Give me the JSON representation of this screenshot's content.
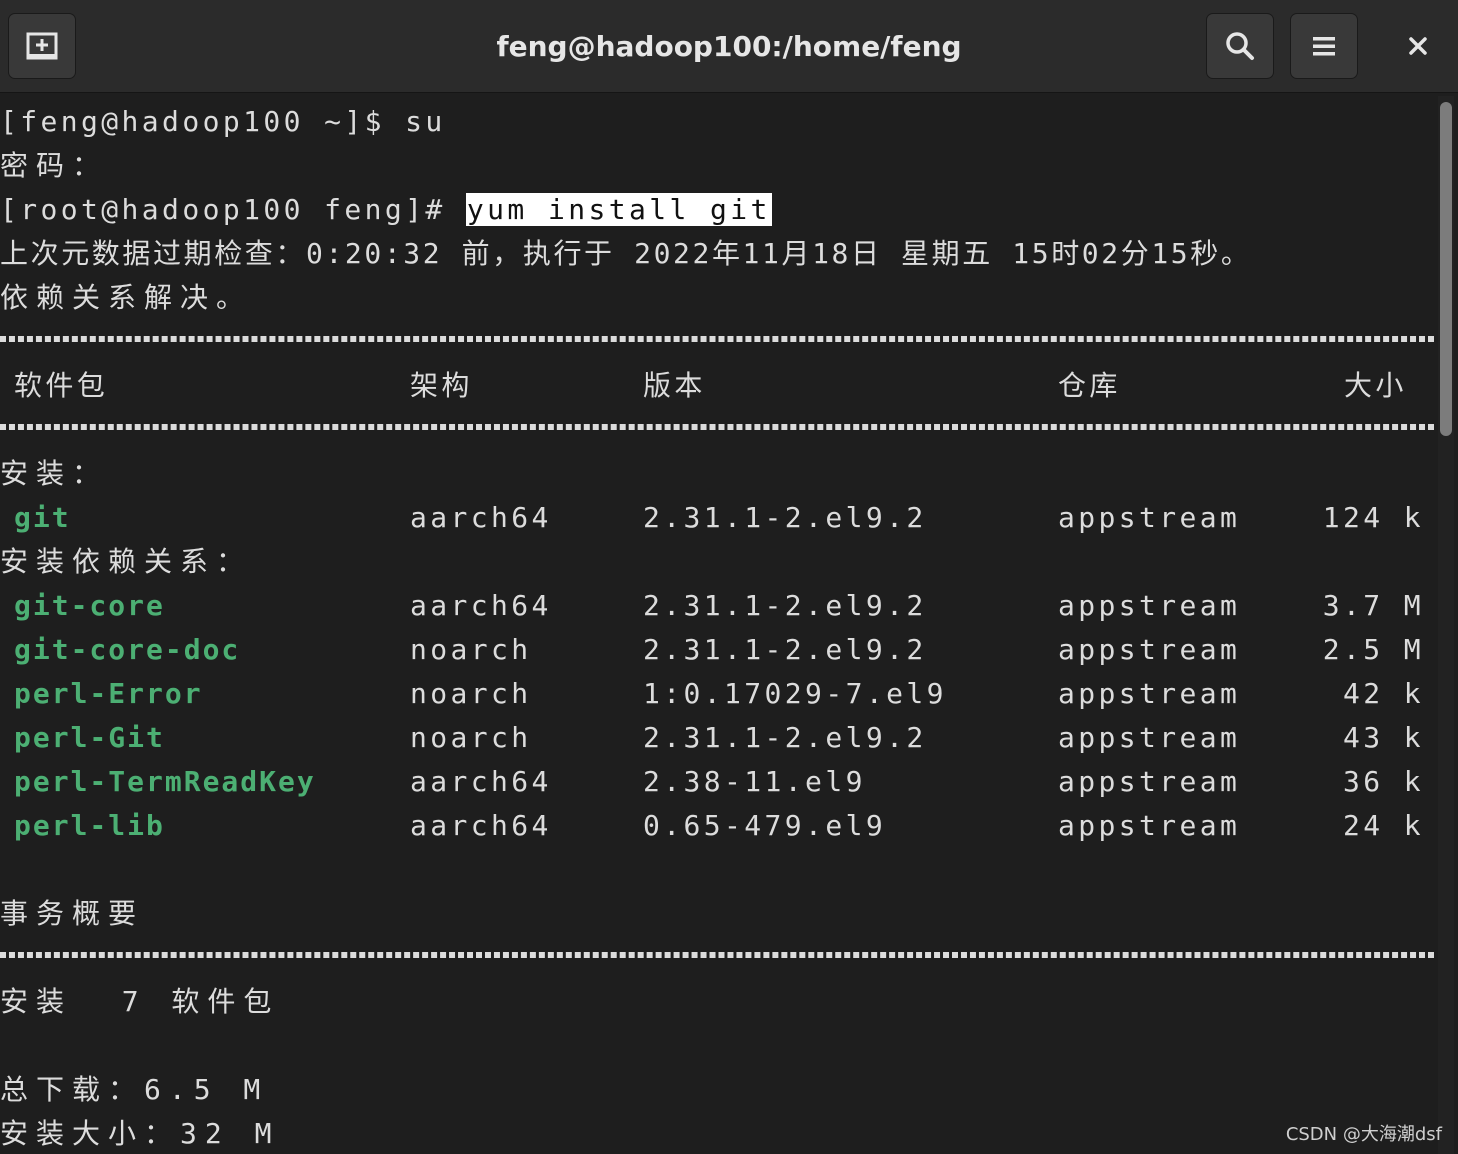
{
  "window": {
    "title": "feng@hadoop100:/home/feng",
    "new_tab_icon": "new-tab-icon",
    "search_icon": "search-icon",
    "menu_icon": "hamburger-menu-icon",
    "close_icon": "close-icon"
  },
  "terminal": {
    "line1": "[feng@hadoop100 ~]$ su",
    "line2": "密码：",
    "prompt3": "[root@hadoop100 feng]# ",
    "command3": "yum install git",
    "line4": "上次元数据过期检查：0:20:32 前，执行于 2022年11月18日 星期五 15时02分15秒。",
    "line5": "依赖关系解决。",
    "headers": {
      "pkg": "软件包",
      "arch": "架构",
      "version": "版本",
      "repo": "仓库",
      "size": "大小"
    },
    "install_label": "安装：",
    "deps_label": "安装依赖关系：",
    "rows": [
      {
        "pkg": "git",
        "arch": "aarch64",
        "version": "2.31.1-2.el9.2",
        "repo": "appstream",
        "size": "124 k"
      },
      {
        "pkg": "git-core",
        "arch": "aarch64",
        "version": "2.31.1-2.el9.2",
        "repo": "appstream",
        "size": "3.7 M"
      },
      {
        "pkg": "git-core-doc",
        "arch": "noarch",
        "version": "2.31.1-2.el9.2",
        "repo": "appstream",
        "size": "2.5 M"
      },
      {
        "pkg": "perl-Error",
        "arch": "noarch",
        "version": "1:0.17029-7.el9",
        "repo": "appstream",
        "size": "42 k"
      },
      {
        "pkg": "perl-Git",
        "arch": "noarch",
        "version": "2.31.1-2.el9.2",
        "repo": "appstream",
        "size": "43 k"
      },
      {
        "pkg": "perl-TermReadKey",
        "arch": "aarch64",
        "version": "2.38-11.el9",
        "repo": "appstream",
        "size": "36 k"
      },
      {
        "pkg": "perl-lib",
        "arch": "aarch64",
        "version": "0.65-479.el9",
        "repo": "appstream",
        "size": "24 k"
      }
    ],
    "summary_label": "事务概要",
    "summary_install": "安装  7 软件包",
    "total_download": "总下载：6.5 M",
    "install_size": "安装大小：32 M"
  },
  "watermark": "CSDN @大海潮dsf"
}
